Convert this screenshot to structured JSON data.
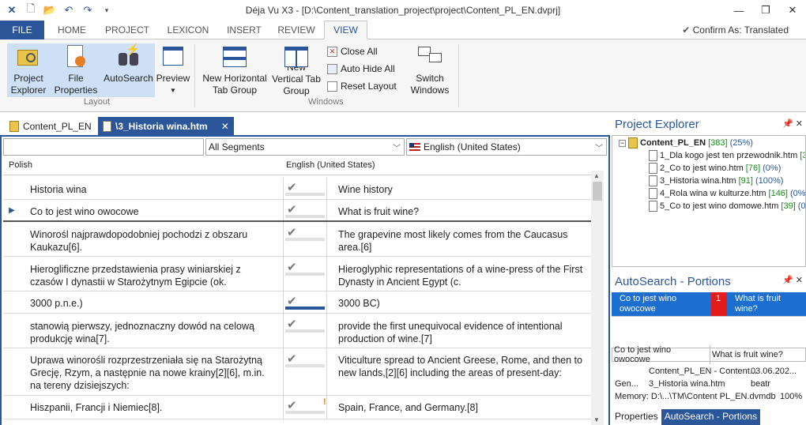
{
  "window": {
    "title": "Déja Vu X3 - [D:\\Content_translation_project\\project\\Content_PL_EN.dvprj]"
  },
  "ribbon_tabs": {
    "file": "FILE",
    "tabs": [
      "HOME",
      "PROJECT",
      "LEXICON",
      "INSERT",
      "REVIEW",
      "VIEW"
    ],
    "confirm": "Confirm As: Translated"
  },
  "ribbon": {
    "project_explorer": "Project Explorer",
    "file_properties": "File Properties",
    "autosearch": "AutoSearch",
    "preview": "Preview",
    "layout_group": "Layout",
    "new_horizontal": "New Horizontal Tab Group",
    "new_vertical": "New Vertical Tab Group",
    "close_all": "Close All",
    "auto_hide_all": "Auto Hide All",
    "reset_layout": "Reset Layout",
    "switch_windows": "Switch Windows",
    "windows_group": "Windows"
  },
  "doc_tabs": {
    "project": "Content_PL_EN",
    "active": "\\3_Historia wina.htm"
  },
  "filters": {
    "segments": "All Segments",
    "language": "English (United States)"
  },
  "columns": {
    "source": "Polish",
    "target": "English (United States)"
  },
  "segments": [
    {
      "src": "Historia wina",
      "tgt": "Wine history"
    },
    {
      "src": "Co to jest wino owocowe",
      "tgt": "What is fruit wine?"
    },
    {
      "src": "Winorośl najprawdopodobniej pochodzi z obszaru Kaukazu[6].",
      "tgt": "The grapevine most likely comes from the Caucasus area.[6]"
    },
    {
      "src": "Hieroglificzne przedstawienia prasy winiarskiej z czasów I dynastii w Starożytnym Egipcie (ok.",
      "tgt": "Hieroglyphic representations of a wine-press of the First Dynasty in Ancient Egypt (c."
    },
    {
      "src": "3000 p.n.e.)",
      "tgt": "3000 BC)"
    },
    {
      "src": "stanowią pierwszy, jednoznaczny dowód na celową produkcję wina[7].",
      "tgt": "provide the first unequivocal evidence of intentional production of wine.[7]"
    },
    {
      "src": "Uprawa winorośli rozprzestrzeniała się na Starożytną Grecję, Rzym, a następnie na nowe krainy[2][6], m.in. na tereny dzisiejszych:",
      "tgt": "Viticulture spread to Ancient Greese, Rome, and then to new lands,[2][6] including the areas of present-day:"
    },
    {
      "src": "Hiszpanii, Francji i Niemiec[8].",
      "tgt": "Spain, France, and Germany.[8]"
    }
  ],
  "project_explorer": {
    "title": "Project Explorer",
    "root": {
      "name": "Content_PL_EN",
      "count": "[383]",
      "pct": "(25%)"
    },
    "files": [
      {
        "name": "1_Dla kogo jest ten przewodnik.htm",
        "count": "[3"
      },
      {
        "name": "2_Co to jest wino.htm",
        "count": "[76]",
        "pct": "(0%)"
      },
      {
        "name": "3_Historia wina.htm",
        "count": "[91]",
        "pct": "(100%)"
      },
      {
        "name": "4_Rola wina w kulturze.htm",
        "count": "[146]",
        "pct": "(0%"
      },
      {
        "name": "5_Co to jest wino domowe.htm",
        "count": "[39]",
        "pct": "(0"
      }
    ]
  },
  "autosearch": {
    "title": "AutoSearch - Portions",
    "src": "Co to jest wino owocowe",
    "num": "1",
    "tgt": "What is fruit wine?",
    "src2": "Co to jest wino owocowe",
    "tgt2": "What is fruit wine?",
    "line1_a": "Content_PL_EN - Content...",
    "line1_b": "03.06.202...",
    "line2_label": "Gen...",
    "line2_a": "3_Historia wina.htm",
    "line2_b": "beatr",
    "line3": "Memory: D:\\...\\TM\\Content PL_EN.dvmdb",
    "line3_b": "100%"
  },
  "bottom_tabs": {
    "properties": "Properties",
    "autosearch": "AutoSearch - Portions"
  }
}
